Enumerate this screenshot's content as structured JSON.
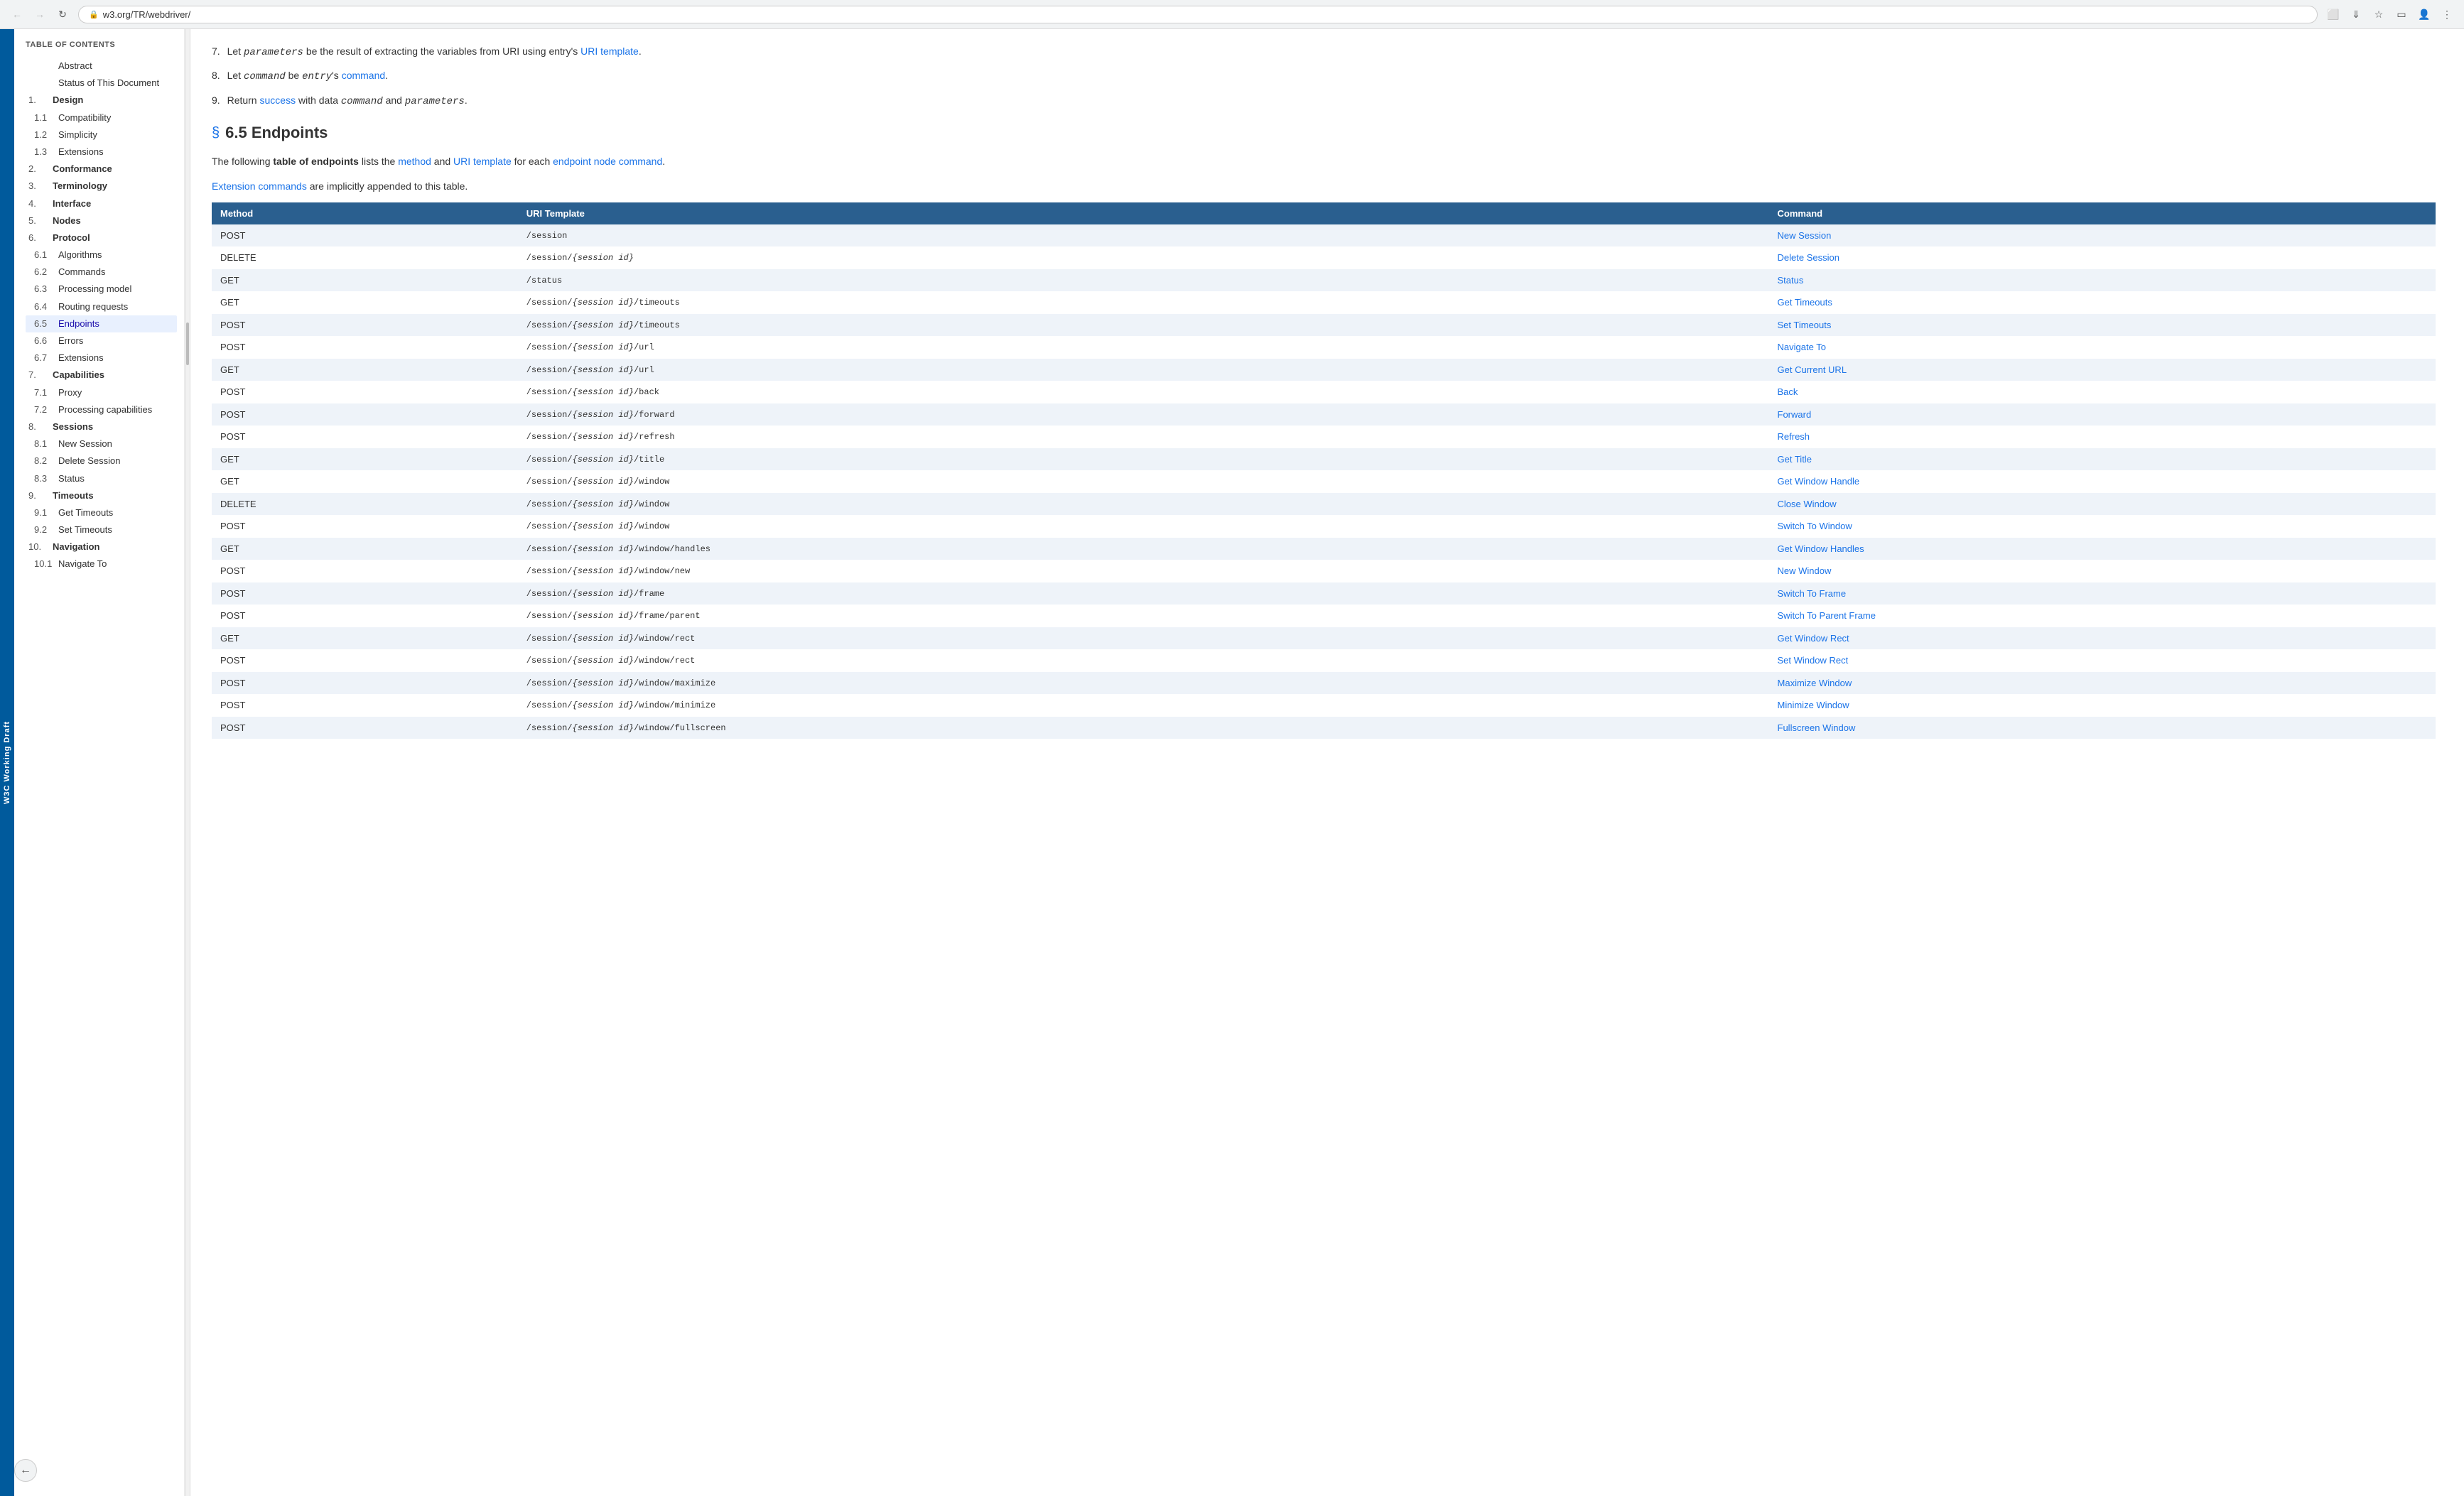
{
  "browser": {
    "url": "w3.org/TR/webdriver/",
    "back_btn": "←",
    "forward_btn": "→",
    "reload_btn": "↻",
    "toolbar_icons": [
      "extensions-icon",
      "bookmark-icon",
      "star-icon",
      "tablet-icon",
      "profile-icon",
      "menu-icon"
    ]
  },
  "w3c_label": "W3C Working Draft",
  "toc": {
    "title": "TABLE OF CONTENTS",
    "items": [
      {
        "num": "",
        "label": "Abstract",
        "level": "top",
        "active": false
      },
      {
        "num": "",
        "label": "Status of This Document",
        "level": "top",
        "active": false
      },
      {
        "num": "1.",
        "label": "Design",
        "level": "section",
        "active": false
      },
      {
        "num": "1.1",
        "label": "Compatibility",
        "level": "sub",
        "active": false
      },
      {
        "num": "1.2",
        "label": "Simplicity",
        "level": "sub",
        "active": false
      },
      {
        "num": "1.3",
        "label": "Extensions",
        "level": "sub",
        "active": false
      },
      {
        "num": "2.",
        "label": "Conformance",
        "level": "section",
        "active": false
      },
      {
        "num": "3.",
        "label": "Terminology",
        "level": "section",
        "active": false
      },
      {
        "num": "4.",
        "label": "Interface",
        "level": "section",
        "active": false
      },
      {
        "num": "5.",
        "label": "Nodes",
        "level": "section",
        "active": false
      },
      {
        "num": "6.",
        "label": "Protocol",
        "level": "section",
        "active": false
      },
      {
        "num": "6.1",
        "label": "Algorithms",
        "level": "sub",
        "active": false
      },
      {
        "num": "6.2",
        "label": "Commands",
        "level": "sub",
        "active": false
      },
      {
        "num": "6.3",
        "label": "Processing model",
        "level": "sub",
        "active": false
      },
      {
        "num": "6.4",
        "label": "Routing requests",
        "level": "sub",
        "active": false
      },
      {
        "num": "6.5",
        "label": "Endpoints",
        "level": "sub",
        "active": true
      },
      {
        "num": "6.6",
        "label": "Errors",
        "level": "sub",
        "active": false
      },
      {
        "num": "6.7",
        "label": "Extensions",
        "level": "sub",
        "active": false
      },
      {
        "num": "7.",
        "label": "Capabilities",
        "level": "section",
        "active": false
      },
      {
        "num": "7.1",
        "label": "Proxy",
        "level": "sub",
        "active": false
      },
      {
        "num": "7.2",
        "label": "Processing capabilities",
        "level": "sub",
        "active": false
      },
      {
        "num": "8.",
        "label": "Sessions",
        "level": "section",
        "active": false
      },
      {
        "num": "8.1",
        "label": "New Session",
        "level": "sub",
        "active": false
      },
      {
        "num": "8.2",
        "label": "Delete Session",
        "level": "sub",
        "active": false
      },
      {
        "num": "8.3",
        "label": "Status",
        "level": "sub",
        "active": false
      },
      {
        "num": "9.",
        "label": "Timeouts",
        "level": "section",
        "active": false
      },
      {
        "num": "9.1",
        "label": "Get Timeouts",
        "level": "sub",
        "active": false
      },
      {
        "num": "9.2",
        "label": "Set Timeouts",
        "level": "sub",
        "active": false
      },
      {
        "num": "10.",
        "label": "Navigation",
        "level": "section",
        "active": false
      },
      {
        "num": "10.1",
        "label": "Navigate To",
        "level": "sub",
        "active": false
      }
    ]
  },
  "content": {
    "steps": [
      {
        "num": "7.",
        "text_before": "Let ",
        "code1": "parameters",
        "text_mid": " be the result of extracting the variables from URI using entry's ",
        "link1_text": "URI template",
        "link1_href": "#",
        "text_after": "."
      },
      {
        "num": "8.",
        "text_before": "Let ",
        "code1": "command",
        "text_mid": " be ",
        "code2": "entry",
        "text_mid2": "'s ",
        "link1_text": "command",
        "link1_href": "#",
        "text_after": "."
      },
      {
        "num": "9.",
        "text_before": "Return ",
        "link1_text": "success",
        "link1_href": "#",
        "text_mid": " with data ",
        "code1": "command",
        "text_mid2": " and ",
        "code2": "parameters",
        "text_after": "."
      }
    ],
    "section_num": "6.5",
    "section_title": "Endpoints",
    "desc1_before": "The following ",
    "desc1_bold": "table of endpoints",
    "desc1_mid": " lists the ",
    "desc1_link1": "method",
    "desc1_and": " and ",
    "desc1_link2": "URI template",
    "desc1_for": " for each ",
    "desc1_link3": "endpoint node command",
    "desc1_end": ".",
    "desc2_link": "Extension commands",
    "desc2_rest": " are implicitly appended to this table.",
    "table": {
      "headers": [
        "Method",
        "URI Template",
        "Command"
      ],
      "rows": [
        {
          "method": "POST",
          "uri": "/session",
          "command": "New Session"
        },
        {
          "method": "DELETE",
          "uri": "/session/{session id}",
          "command": "Delete Session"
        },
        {
          "method": "GET",
          "uri": "/status",
          "command": "Status"
        },
        {
          "method": "GET",
          "uri": "/session/{session id}/timeouts",
          "command": "Get Timeouts"
        },
        {
          "method": "POST",
          "uri": "/session/{session id}/timeouts",
          "command": "Set Timeouts"
        },
        {
          "method": "POST",
          "uri": "/session/{session id}/url",
          "command": "Navigate To"
        },
        {
          "method": "GET",
          "uri": "/session/{session id}/url",
          "command": "Get Current URL"
        },
        {
          "method": "POST",
          "uri": "/session/{session id}/back",
          "command": "Back"
        },
        {
          "method": "POST",
          "uri": "/session/{session id}/forward",
          "command": "Forward"
        },
        {
          "method": "POST",
          "uri": "/session/{session id}/refresh",
          "command": "Refresh"
        },
        {
          "method": "GET",
          "uri": "/session/{session id}/title",
          "command": "Get Title"
        },
        {
          "method": "GET",
          "uri": "/session/{session id}/window",
          "command": "Get Window Handle"
        },
        {
          "method": "DELETE",
          "uri": "/session/{session id}/window",
          "command": "Close Window"
        },
        {
          "method": "POST",
          "uri": "/session/{session id}/window",
          "command": "Switch To Window"
        },
        {
          "method": "GET",
          "uri": "/session/{session id}/window/handles",
          "command": "Get Window Handles"
        },
        {
          "method": "POST",
          "uri": "/session/{session id}/window/new",
          "command": "New Window"
        },
        {
          "method": "POST",
          "uri": "/session/{session id}/frame",
          "command": "Switch To Frame"
        },
        {
          "method": "POST",
          "uri": "/session/{session id}/frame/parent",
          "command": "Switch To Parent Frame"
        },
        {
          "method": "GET",
          "uri": "/session/{session id}/window/rect",
          "command": "Get Window Rect"
        },
        {
          "method": "POST",
          "uri": "/session/{session id}/window/rect",
          "command": "Set Window Rect"
        },
        {
          "method": "POST",
          "uri": "/session/{session id}/window/maximize",
          "command": "Maximize Window"
        },
        {
          "method": "POST",
          "uri": "/session/{session id}/window/minimize",
          "command": "Minimize Window"
        },
        {
          "method": "POST",
          "uri": "/session/{session id}/window/fullscreen",
          "command": "Fullscreen Window"
        }
      ]
    }
  },
  "back_button_label": "←"
}
